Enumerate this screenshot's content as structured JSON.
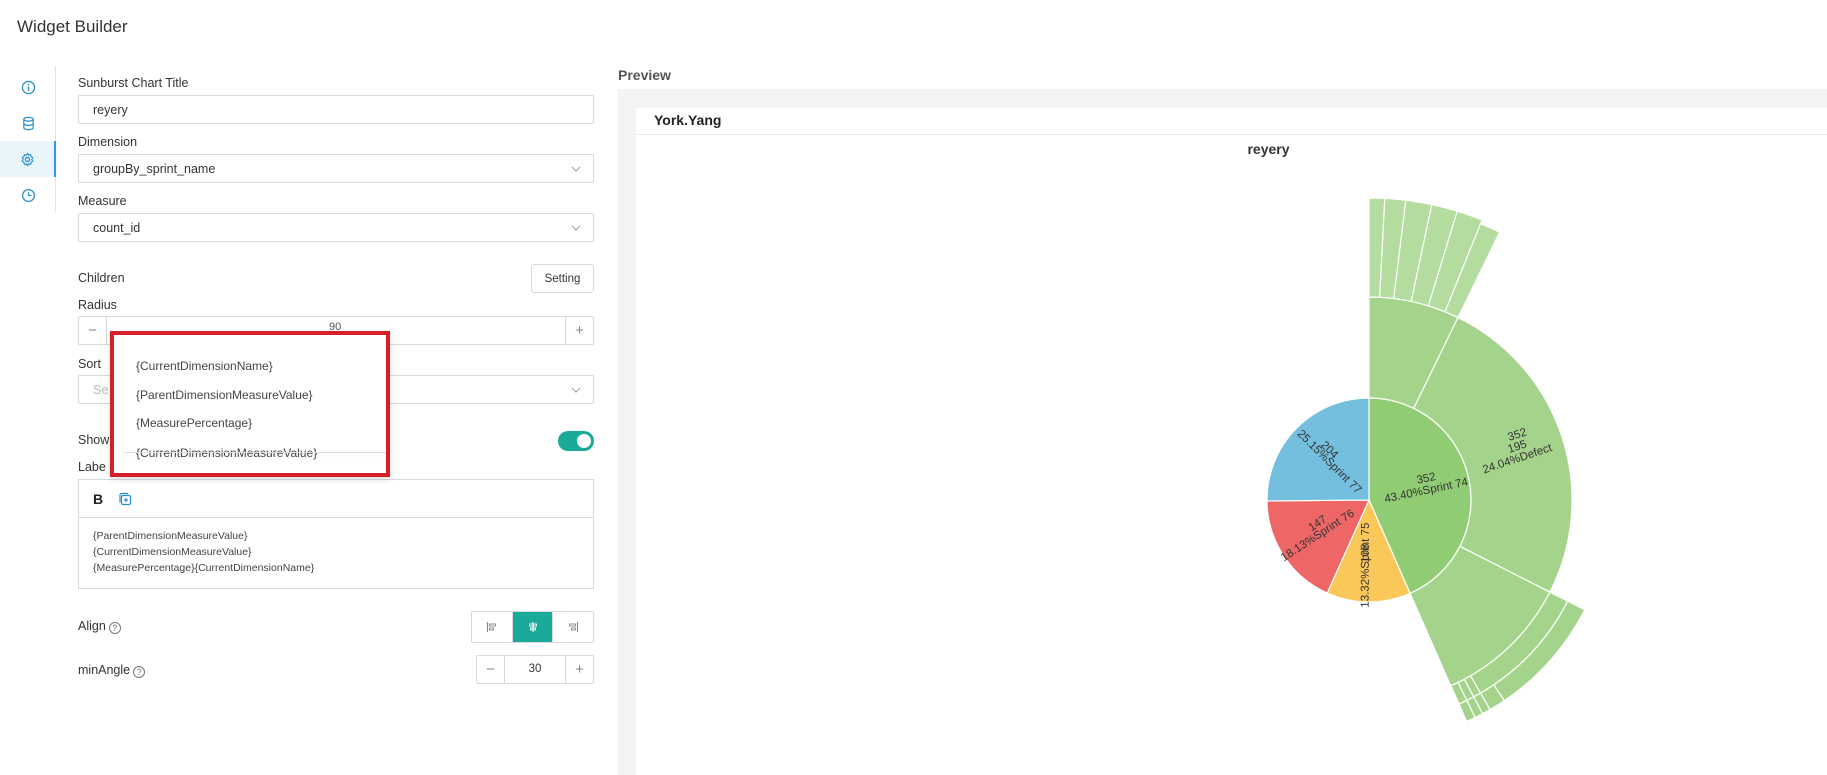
{
  "app": {
    "title": "Widget Builder"
  },
  "rail": {
    "items": [
      {
        "icon": "info-icon"
      },
      {
        "icon": "database-icon"
      },
      {
        "icon": "gear-icon",
        "active": true
      },
      {
        "icon": "clock-icon"
      }
    ]
  },
  "form": {
    "title_label": "Sunburst Chart Title",
    "title_value": "reyery",
    "dimension_label": "Dimension",
    "dimension_value": "groupBy_sprint_name",
    "measure_label": "Measure",
    "measure_value": "count_id",
    "children_label": "Children",
    "setting_button": "Setting",
    "radius_label": "Radius",
    "radius_value": "90",
    "sort_label": "Sort",
    "sort_placeholder": "Se",
    "show_label": "Show",
    "show_toggle_on": true,
    "label_label": "Labe",
    "label_template_lines": [
      "{ParentDimensionMeasureValue}",
      "{CurrentDimensionMeasureValue}",
      "{MeasurePercentage}{CurrentDimensionName}"
    ],
    "bold_button": "B",
    "align_label": "Align",
    "align_selected": "center",
    "min_angle_label": "minAngle",
    "min_angle_value": "30",
    "help_glyph": "?"
  },
  "popup": {
    "items": [
      "{CurrentDimensionName}",
      "{ParentDimensionMeasureValue}",
      "{MeasurePercentage}",
      "{CurrentDimensionMeasureValue}"
    ]
  },
  "preview": {
    "title": "Preview",
    "card_user": "York.Yang",
    "chart_title": "reyery"
  },
  "colors": {
    "accent": "#1aaa9a",
    "highlight_border": "#d5202a",
    "icon_blue": "#2a8fc8"
  },
  "chart_data": {
    "type": "sunburst",
    "title": "reyery",
    "inner": [
      {
        "name": "Sprint 74",
        "value": 352,
        "percent": "43.40%",
        "color": "#90cc73"
      },
      {
        "name": "Sprint 75",
        "value": 108,
        "percent": "13.32%",
        "color": "#fac759"
      },
      {
        "name": "Sprint 76",
        "value": 147,
        "percent": "18.13%",
        "color": "#ee6666"
      },
      {
        "name": "Sprint 77",
        "value": 204,
        "percent": "25.15%",
        "color": "#73bfdd"
      }
    ],
    "inner_labels": [
      [
        "352",
        "43.40%Sprint 74"
      ],
      [
        "108",
        "13.32%Sprint 75"
      ],
      [
        "147",
        "18.13%Sprint 76"
      ],
      [
        "204",
        "25.15%Sprint 77"
      ]
    ],
    "middle_labels": [
      "352",
      "195",
      "24.04%Defect"
    ]
  }
}
